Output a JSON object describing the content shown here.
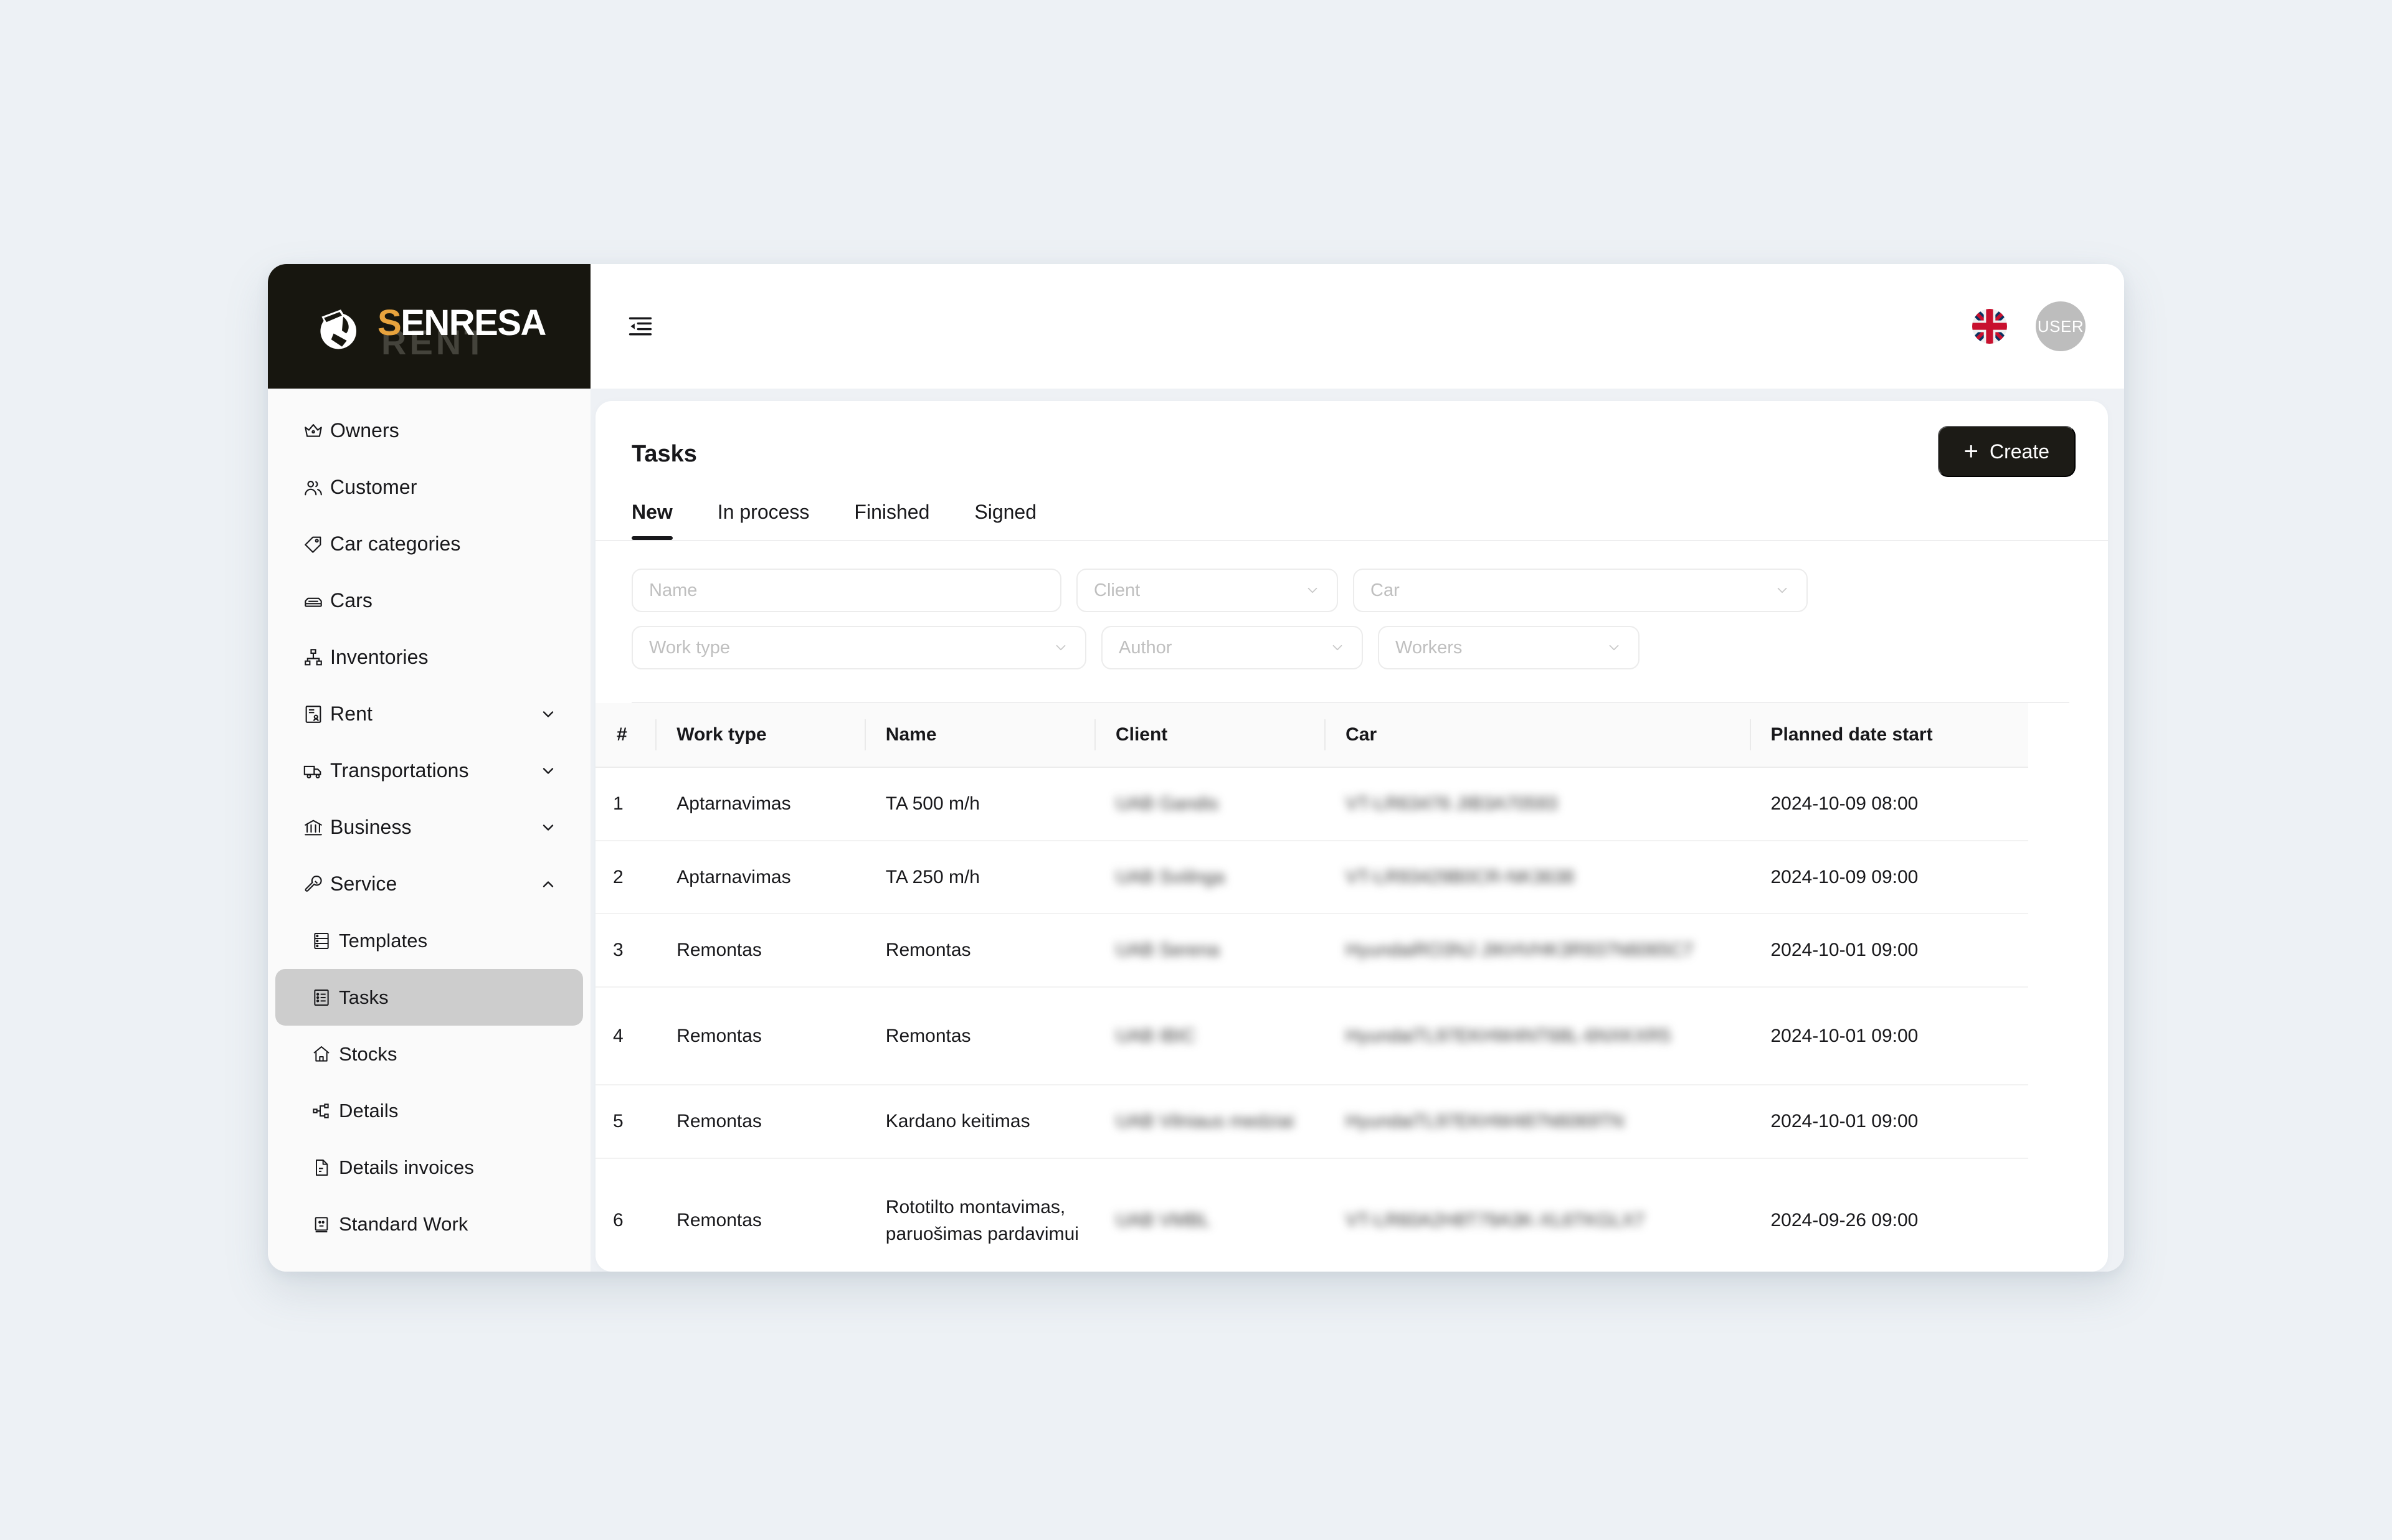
{
  "brand": {
    "name_primary_first": "S",
    "name_primary_rest": "ENRESA",
    "name_secondary": "RENT",
    "accent_color": "#e8a33d",
    "dark_color": "#17160f"
  },
  "topbar": {
    "menu_fold_icon": "menu-fold-icon",
    "language_flag": "uk-flag-icon",
    "avatar_label": "USER"
  },
  "sidebar": {
    "items": [
      {
        "label": "Owners",
        "icon": "crown-icon",
        "expandable": false,
        "sub": false
      },
      {
        "label": "Customer",
        "icon": "users-icon",
        "expandable": false,
        "sub": false
      },
      {
        "label": "Car categories",
        "icon": "tag-icon",
        "expandable": false,
        "sub": false
      },
      {
        "label": "Cars",
        "icon": "car-icon",
        "expandable": false,
        "sub": false
      },
      {
        "label": "Inventories",
        "icon": "sitemap-icon",
        "expandable": false,
        "sub": false
      },
      {
        "label": "Rent",
        "icon": "contract-icon",
        "expandable": true,
        "sub": false,
        "chevron": "chevron-down-icon"
      },
      {
        "label": "Transportations",
        "icon": "truck-icon",
        "expandable": true,
        "sub": false,
        "chevron": "chevron-down-icon"
      },
      {
        "label": "Business",
        "icon": "bank-icon",
        "expandable": true,
        "sub": false,
        "chevron": "chevron-down-icon"
      },
      {
        "label": "Service",
        "icon": "wrench-icon",
        "expandable": true,
        "sub": false,
        "chevron": "chevron-up-icon",
        "expanded": true
      },
      {
        "label": "Templates",
        "icon": "template-icon",
        "expandable": false,
        "sub": true
      },
      {
        "label": "Tasks",
        "icon": "tasks-icon",
        "expandable": false,
        "sub": true,
        "active": true
      },
      {
        "label": "Stocks",
        "icon": "home-icon",
        "expandable": false,
        "sub": true
      },
      {
        "label": "Details",
        "icon": "nodes-icon",
        "expandable": false,
        "sub": true
      },
      {
        "label": "Details invoices",
        "icon": "file-text-icon",
        "expandable": false,
        "sub": true
      },
      {
        "label": "Standard Work",
        "icon": "card-icon",
        "expandable": false,
        "sub": true
      }
    ]
  },
  "page": {
    "title": "Tasks",
    "create_button": "Create",
    "create_icon": "plus-icon",
    "tabs": [
      {
        "label": "New",
        "active": true
      },
      {
        "label": "In process",
        "active": false
      },
      {
        "label": "Finished",
        "active": false
      },
      {
        "label": "Signed",
        "active": false
      }
    ]
  },
  "filters": {
    "row1": [
      {
        "name": "name",
        "placeholder": "Name",
        "value": "",
        "type": "text"
      },
      {
        "name": "client",
        "placeholder": "Client",
        "value": "",
        "type": "select",
        "caret": "chevron-down-icon"
      },
      {
        "name": "car",
        "placeholder": "Car",
        "value": "",
        "type": "select",
        "caret": "chevron-down-icon"
      }
    ],
    "row2": [
      {
        "name": "work_type",
        "placeholder": "Work type",
        "value": "",
        "type": "select",
        "caret": "chevron-down-icon"
      },
      {
        "name": "author",
        "placeholder": "Author",
        "value": "",
        "type": "select",
        "caret": "chevron-down-icon"
      },
      {
        "name": "workers",
        "placeholder": "Workers",
        "value": "",
        "type": "select",
        "caret": "chevron-down-icon"
      }
    ]
  },
  "table": {
    "columns": [
      "#",
      "Work type",
      "Name",
      "Client",
      "Car",
      "Planned date start"
    ],
    "rows": [
      {
        "num": "1",
        "work_type": "Aptarnavimas",
        "name": "TA 500 m/h",
        "client": "UAB Gandis",
        "car": "VT-LR63476 JIB3A70593",
        "date": "2024-10-09 08:00"
      },
      {
        "num": "2",
        "work_type": "Aptarnavimas",
        "name": "TA 250 m/h",
        "client": "UAB Sviilnga",
        "car": "VT-LR93429B0CR-NK3638",
        "date": "2024-10-09 09:00"
      },
      {
        "num": "3",
        "work_type": "Remontas",
        "name": "Remontas",
        "client": "UAB Serena",
        "car": "HyundaiRO3NJ JIKHVHK3R937N6065C7",
        "date": "2024-10-01 09:00"
      },
      {
        "num": "4",
        "work_type": "Remontas",
        "name": "Remontas",
        "client": "UAB IBIC",
        "car": "HyundaiTL97EKHW4NT68L-6NXKXR5",
        "date": "2024-10-01 09:00"
      },
      {
        "num": "5",
        "work_type": "Remontas",
        "name": "Kardano keitimas",
        "client": "UAB Vilniaus medziai",
        "car": "HyundaiTL97EKHW487N6069TN",
        "date": "2024-10-01 09:00"
      },
      {
        "num": "6",
        "work_type": "Remontas",
        "name": "Rototilto montavimas, paruošimas pardavimui",
        "client": "UAB VMBL",
        "car": "VT-LR60A2H8T79A3K-XL6TKGLX7",
        "date": "2024-09-26 09:00"
      }
    ]
  }
}
